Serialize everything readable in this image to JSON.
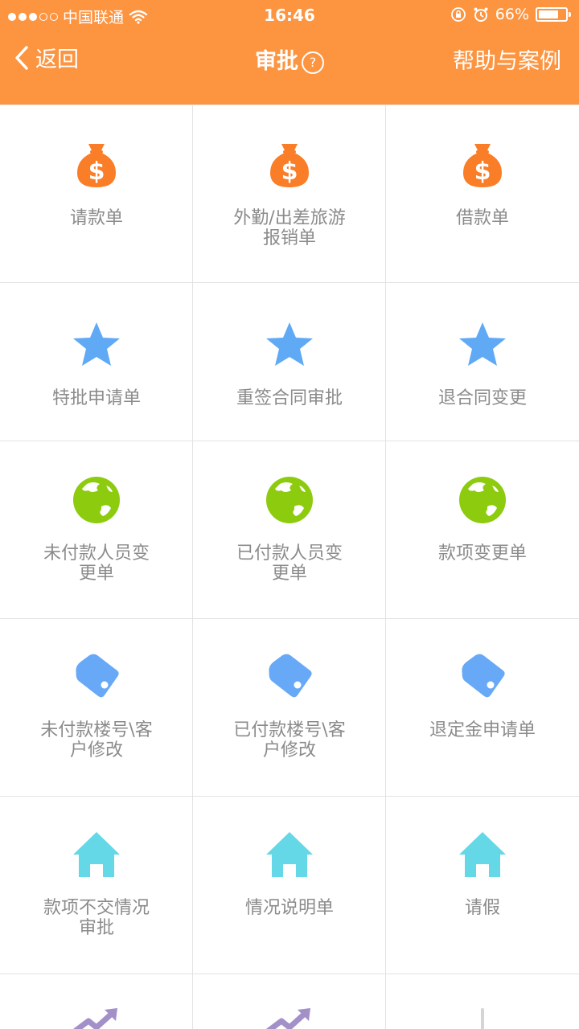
{
  "status": {
    "carrier": "中国联通",
    "time": "16:46",
    "battery": "66%"
  },
  "nav": {
    "back_label": "返回",
    "title": "审批",
    "help_icon": "?",
    "right_label": "帮助与案例"
  },
  "colors": {
    "header": "#FD9440",
    "money": "#FA7D27",
    "star": "#5FA9F5",
    "globe": "#8DCB0F",
    "tag": "#67A9F6",
    "house": "#64D8E6",
    "trend": "#A390C9"
  },
  "grid": {
    "rows": [
      {
        "items": [
          {
            "icon": "money-bag-icon",
            "line1": "请款单",
            "line2": ""
          },
          {
            "icon": "money-bag-icon",
            "line1": "外勤/出差旅游",
            "line2": "报销单"
          },
          {
            "icon": "money-bag-icon",
            "line1": "借款单",
            "line2": ""
          }
        ]
      },
      {
        "items": [
          {
            "icon": "star-icon",
            "line1": "特批申请单",
            "line2": ""
          },
          {
            "icon": "star-icon",
            "line1": "重签合同审批",
            "line2": ""
          },
          {
            "icon": "star-icon",
            "line1": "退合同变更",
            "line2": ""
          }
        ]
      },
      {
        "items": [
          {
            "icon": "globe-icon",
            "line1": "未付款人员变",
            "line2": "更单"
          },
          {
            "icon": "globe-icon",
            "line1": "已付款人员变",
            "line2": "更单"
          },
          {
            "icon": "globe-icon",
            "line1": "款项变更单",
            "line2": ""
          }
        ]
      },
      {
        "items": [
          {
            "icon": "tag-icon",
            "line1": "未付款楼号\\客",
            "line2": "户修改"
          },
          {
            "icon": "tag-icon",
            "line1": "已付款楼号\\客",
            "line2": "户修改"
          },
          {
            "icon": "tag-icon",
            "line1": "退定金申请单",
            "line2": ""
          }
        ]
      },
      {
        "items": [
          {
            "icon": "house-icon",
            "line1": "款项不交情况",
            "line2": "审批"
          },
          {
            "icon": "house-icon",
            "line1": "情况说明单",
            "line2": ""
          },
          {
            "icon": "house-icon",
            "line1": "请假",
            "line2": ""
          }
        ]
      }
    ]
  }
}
